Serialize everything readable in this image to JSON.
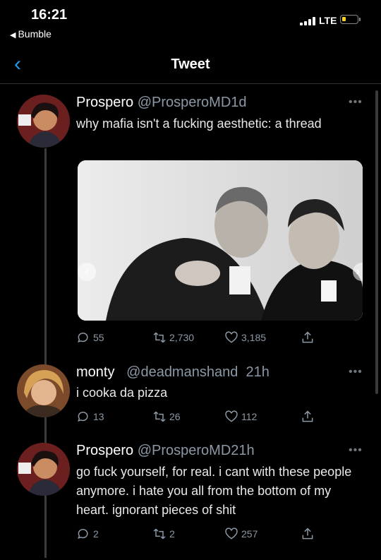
{
  "status_bar": {
    "time": "16:21",
    "back_app": "Bumble",
    "network": "LTE"
  },
  "nav": {
    "title": "Tweet"
  },
  "tweets": [
    {
      "name": "Prospero",
      "handle": "@ProsperoMD",
      "time": "1d",
      "text": "why mafia isn't a fucking aesthetic: a thread",
      "has_media": true,
      "replies": "55",
      "retweets": "2,730",
      "likes": "3,185"
    },
    {
      "name": "monty",
      "handle": "@deadmanshand",
      "time": "21h",
      "text": "i cooka da pizza",
      "replies": "13",
      "retweets": "26",
      "likes": "112"
    },
    {
      "name": "Prospero",
      "handle": "@ProsperoMD",
      "time": "21h",
      "text": "go fuck yourself, for real. i cant with these people anymore. i hate you all from the bottom of my heart. ignorant pieces of shit",
      "replies": "2",
      "retweets": "2",
      "likes": "257"
    }
  ],
  "icons": {
    "reply": "reply-icon",
    "retweet": "retweet-icon",
    "like": "heart-icon",
    "share": "share-icon",
    "more": "more-icon"
  },
  "colors": {
    "accent": "#1d9bf0",
    "muted": "#8b98a5",
    "battery": "#f5d327"
  }
}
